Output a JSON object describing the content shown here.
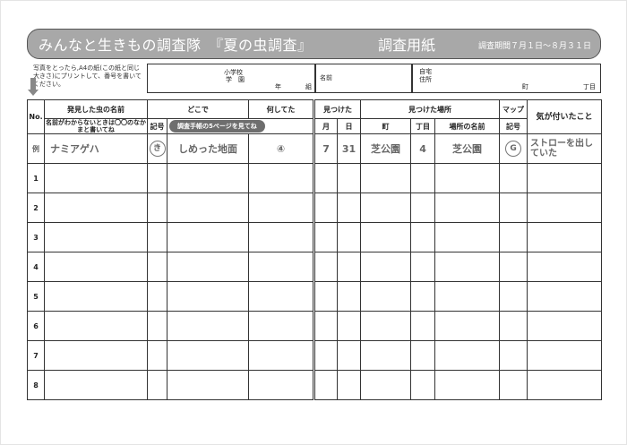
{
  "header": {
    "title": "みんなと生きもの調査隊　『夏の虫調査』",
    "subtitle": "調査用紙",
    "period": "調査期間７月１日～８月３１日"
  },
  "note": "写真をとったら,A4の紙(この紙と同じ大きさ)にプリントして、番号を書いてください。",
  "school": {
    "label_school": "小学校",
    "label_gakuen": "学　園",
    "label_year": "年",
    "label_class": "組"
  },
  "name_label": "名前",
  "home": {
    "label_home": "自宅",
    "label_address": "住所",
    "label_town": "町",
    "label_chome": "丁目"
  },
  "columns": {
    "no": "No.",
    "bug_name": "発見した虫の名前",
    "bug_name_note": "名前がわからないときは〇〇のなかまと書いてね",
    "where": "どこで",
    "symbol": "記号",
    "manual_button": "調査手帳の5ページを見てね",
    "doing": "何してた",
    "found_when": "見つけた",
    "month": "月",
    "day": "日",
    "found_place": "見つけた場所",
    "town": "町",
    "chome": "丁目",
    "place_name": "場所の名前",
    "map": "マップ",
    "map_symbol": "記号",
    "noticed": "気が付いたこと"
  },
  "example": {
    "no": "例",
    "bug_name": "ナミアゲハ",
    "where_symbol": "き",
    "where_text": "しめった地面",
    "doing": "④",
    "month": "7",
    "day": "31",
    "town": "芝公園",
    "chome": "4",
    "place_name": "芝公園",
    "map_symbol": "G",
    "noticed": "ストローを出していた"
  },
  "rows": [
    "1",
    "2",
    "3",
    "4",
    "5",
    "6",
    "7",
    "8"
  ]
}
